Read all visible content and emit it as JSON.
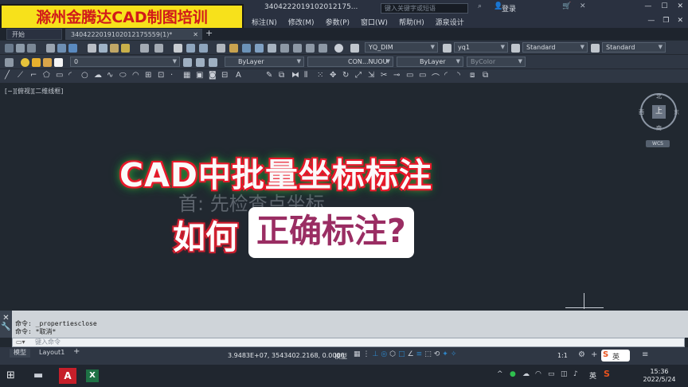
{
  "brand": {
    "text": "滁州金腾达CAD制图培训"
  },
  "titlebar": {
    "doc_name": "3404222019102012175...",
    "search_placeholder": "键入关键字或短语",
    "login": "登录"
  },
  "menubar": {
    "items": [
      "标注(N)",
      "修改(M)",
      "参数(P)",
      "窗口(W)",
      "帮助(H)",
      "源泉设计"
    ]
  },
  "tabs": {
    "start": "开始",
    "file": "3404222019102012175559(1)*"
  },
  "toolbar1": {
    "dimstyle": "YQ_DIM",
    "textstyle": "yq1",
    "tablestyle": "Standard",
    "mleaderstyle": "Standard"
  },
  "toolbar2": {
    "layer": "0",
    "color": "ByLayer",
    "linetype": "CON...NUOU",
    "lineweight": "ByLayer",
    "plotstyle": "ByColor"
  },
  "canvas": {
    "view_label": "[−][俯视][二维线框]",
    "headline": "CAD中批量坐标标注",
    "ghost_text": "首: 先检查点坐标",
    "sub_left": "如何",
    "sub_right": "正确标注?"
  },
  "viewcube": {
    "top": "上",
    "north": "北",
    "south": "南",
    "east": "东",
    "west": "西",
    "wcs": "WCS"
  },
  "command": {
    "line1": "命令: _propertiesclose",
    "line2": "命令: *取消*",
    "input_placeholder": "键入命令"
  },
  "layouts": {
    "model": "模型",
    "layout1": "Layout1"
  },
  "status": {
    "coords": "3.9483E+07, 3543402.2168, 0.0000",
    "model": "模型",
    "scale": "1:1"
  },
  "taskbar": {
    "ime": "英",
    "time": "15:36",
    "date": "2022/5/24"
  },
  "colors": {
    "canvas": "#212830",
    "brand_bg": "#f7e11b",
    "brand_text": "#d11a1a",
    "glow_red": "#e8192b",
    "glow_green": "#18a33a",
    "sub_magenta": "#9a2d63"
  }
}
